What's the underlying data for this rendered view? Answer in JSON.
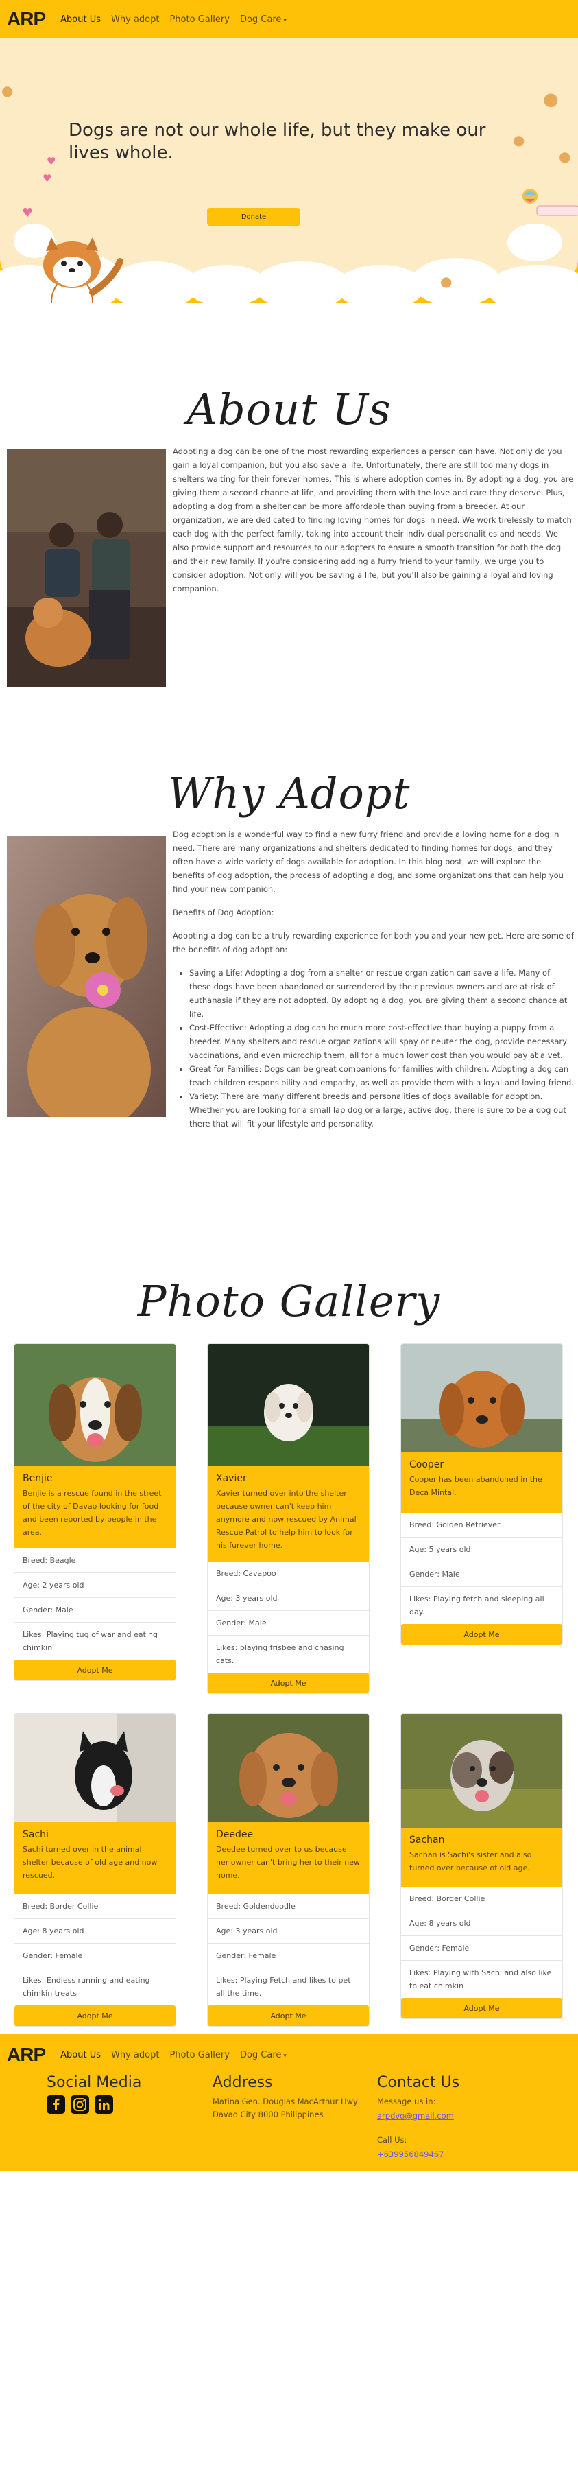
{
  "nav": {
    "brand": "ARP",
    "links": [
      "About Us",
      "Why adopt",
      "Photo Gallery",
      "Dog Care"
    ],
    "caret": "▾"
  },
  "hero": {
    "headline": "Dogs are not our whole life, but they make our lives whole.",
    "donate_label": "Donate"
  },
  "about": {
    "title": "About Us",
    "text": "Adopting a dog can be one of the most rewarding experiences a person can have. Not only do you gain a loyal companion, but you also save a life. Unfortunately, there are still too many dogs in shelters waiting for their forever homes. This is where adoption comes in. By adopting a dog, you are giving them a second chance at life, and providing them with the love and care they deserve. Plus, adopting a dog from a shelter can be more affordable than buying from a breeder. At our organization, we are dedicated to finding loving homes for dogs in need. We work tirelessly to match each dog with the perfect family, taking into account their individual personalities and needs. We also provide support and resources to our adopters to ensure a smooth transition for both the dog and their new family. If you're considering adding a furry friend to your family, we urge you to consider adoption. Not only will you be saving a life, but you'll also be gaining a loyal and loving companion."
  },
  "why": {
    "title": "Why Adopt",
    "intro": "Dog adoption is a wonderful way to find a new furry friend and provide a loving home for a dog in need. There are many organizations and shelters dedicated to finding homes for dogs, and they often have a wide variety of dogs available for adoption. In this blog post, we will explore the benefits of dog adoption, the process of adopting a dog, and some organizations that can help you find your new companion.",
    "benefits_heading": "Benefits of Dog Adoption:",
    "benefits_intro": "Adopting a dog can be a truly rewarding experience for both you and your new pet. Here are some of the benefits of dog adoption:",
    "benefits": [
      "Saving a Life: Adopting a dog from a shelter or rescue organization can save a life. Many of these dogs have been abandoned or surrendered by their previous owners and are at risk of euthanasia if they are not adopted. By adopting a dog, you are giving them a second chance at life.",
      "Cost-Effective: Adopting a dog can be much more cost-effective than buying a puppy from a breeder. Many shelters and rescue organizations will spay or neuter the dog, provide necessary vaccinations, and even microchip them, all for a much lower cost than you would pay at a vet.",
      "Great for Families: Dogs can be great companions for families with children. Adopting a dog can teach children responsibility and empathy, as well as provide them with a loyal and loving friend.",
      "Variety: There are many different breeds and personalities of dogs available for adoption. Whether you are looking for a small lap dog or a large, active dog, there is sure to be a dog out there that will fit your lifestyle and personality."
    ]
  },
  "gallery": {
    "title": "Photo Gallery",
    "adopt_label": "Adopt Me",
    "dogs": [
      {
        "name": "Benjie",
        "desc": "Benjie is a rescue found in the street of the city of Davao looking for food and been reported by people in the area.",
        "breed": "Breed: Beagle",
        "age": "Age: 2 years old",
        "gender": "Gender: Male",
        "likes": "Likes: Playing tug of war and eating chimkin"
      },
      {
        "name": "Xavier",
        "desc": "Xavier turned over into the shelter because owner can't keep him anymore and now rescued by Animal Rescue Patrol to help him to look for his furever home.",
        "breed": "Breed: Cavapoo",
        "age": "Age: 3 years old",
        "gender": "Gender: Male",
        "likes": "Likes: playing frisbee and chasing cats."
      },
      {
        "name": "Cooper",
        "desc": "Cooper has been abandoned in the Deca Mintal.",
        "breed": "Breed: Golden Retriever",
        "age": "Age: 5 years old",
        "gender": "Gender: Male",
        "likes": "Likes: Playing fetch and sleeping all day."
      },
      {
        "name": "Sachi",
        "desc": "Sachi turned over in the animal shelter because of old age and now rescued.",
        "breed": "Breed: Border Collie",
        "age": "Age: 8 years old",
        "gender": "Gender: Female",
        "likes": "Likes: Endless running and eating chimkin treats"
      },
      {
        "name": "Deedee",
        "desc": "Deedee turned over to us because her owner can't bring her to their new home.",
        "breed": "Breed: Goldendoodle",
        "age": "Age: 3 years old",
        "gender": "Gender: Female",
        "likes": "Likes: Playing Fetch and likes to pet all the time."
      },
      {
        "name": "Sachan",
        "desc": "Sachan is Sachi's sister and also turned over because of old age.",
        "breed": "Breed: Border Collie",
        "age": "Age: 8 years old",
        "gender": "Gender: Female",
        "likes": "Likes: Playing with Sachi and also like to eat chimkin"
      }
    ]
  },
  "footer": {
    "social_title": "Social Media",
    "address_title": "Address",
    "address_text": "Matina Gen. Douglas MacArthur Hwy Davao City 8000 Philippines",
    "contact_title": "Contact Us",
    "message_label": "Message us in:",
    "email": "arpdvo@gmail.com",
    "call_label": "Call Us:",
    "phone": "+639956849467"
  }
}
